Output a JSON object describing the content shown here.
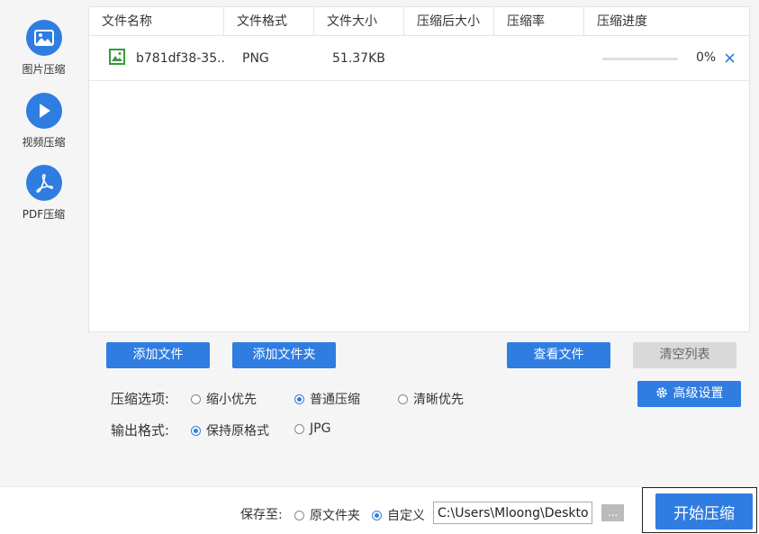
{
  "sidebar": {
    "items": [
      {
        "label": "图片压缩",
        "icon": "image-icon"
      },
      {
        "label": "视频压缩",
        "icon": "play-icon"
      },
      {
        "label": "PDF压缩",
        "icon": "pdf-icon"
      }
    ]
  },
  "table": {
    "columns": [
      "文件名称",
      "文件格式",
      "文件大小",
      "压缩后大小",
      "压缩率",
      "压缩进度"
    ],
    "rows": [
      {
        "name": "b781df38-35...",
        "format": "PNG",
        "size": "51.37KB",
        "compressed_size": "",
        "ratio": "",
        "progress": "0%",
        "progress_value": 0
      }
    ]
  },
  "buttons": {
    "add_file": "添加文件",
    "add_folder": "添加文件夹",
    "view_files": "查看文件",
    "clear_list": "清空列表",
    "advanced": "高级设置",
    "start": "开始压缩"
  },
  "options": {
    "compress_label": "压缩选项:",
    "compress_choices": [
      "缩小优先",
      "普通压缩",
      "清晰优先"
    ],
    "compress_selected": "普通压缩",
    "format_label": "输出格式:",
    "format_choices": [
      "保持原格式",
      "JPG"
    ],
    "format_selected": "保持原格式"
  },
  "footer": {
    "save_label": "保存至:",
    "save_choices": [
      "原文件夹",
      "自定义"
    ],
    "save_selected": "自定义",
    "path_value": "C:\\Users\\Mloong\\Desktop",
    "browse_label": "..."
  },
  "colors": {
    "accent": "#2f7de1",
    "gray_button": "#d9d9d9"
  }
}
